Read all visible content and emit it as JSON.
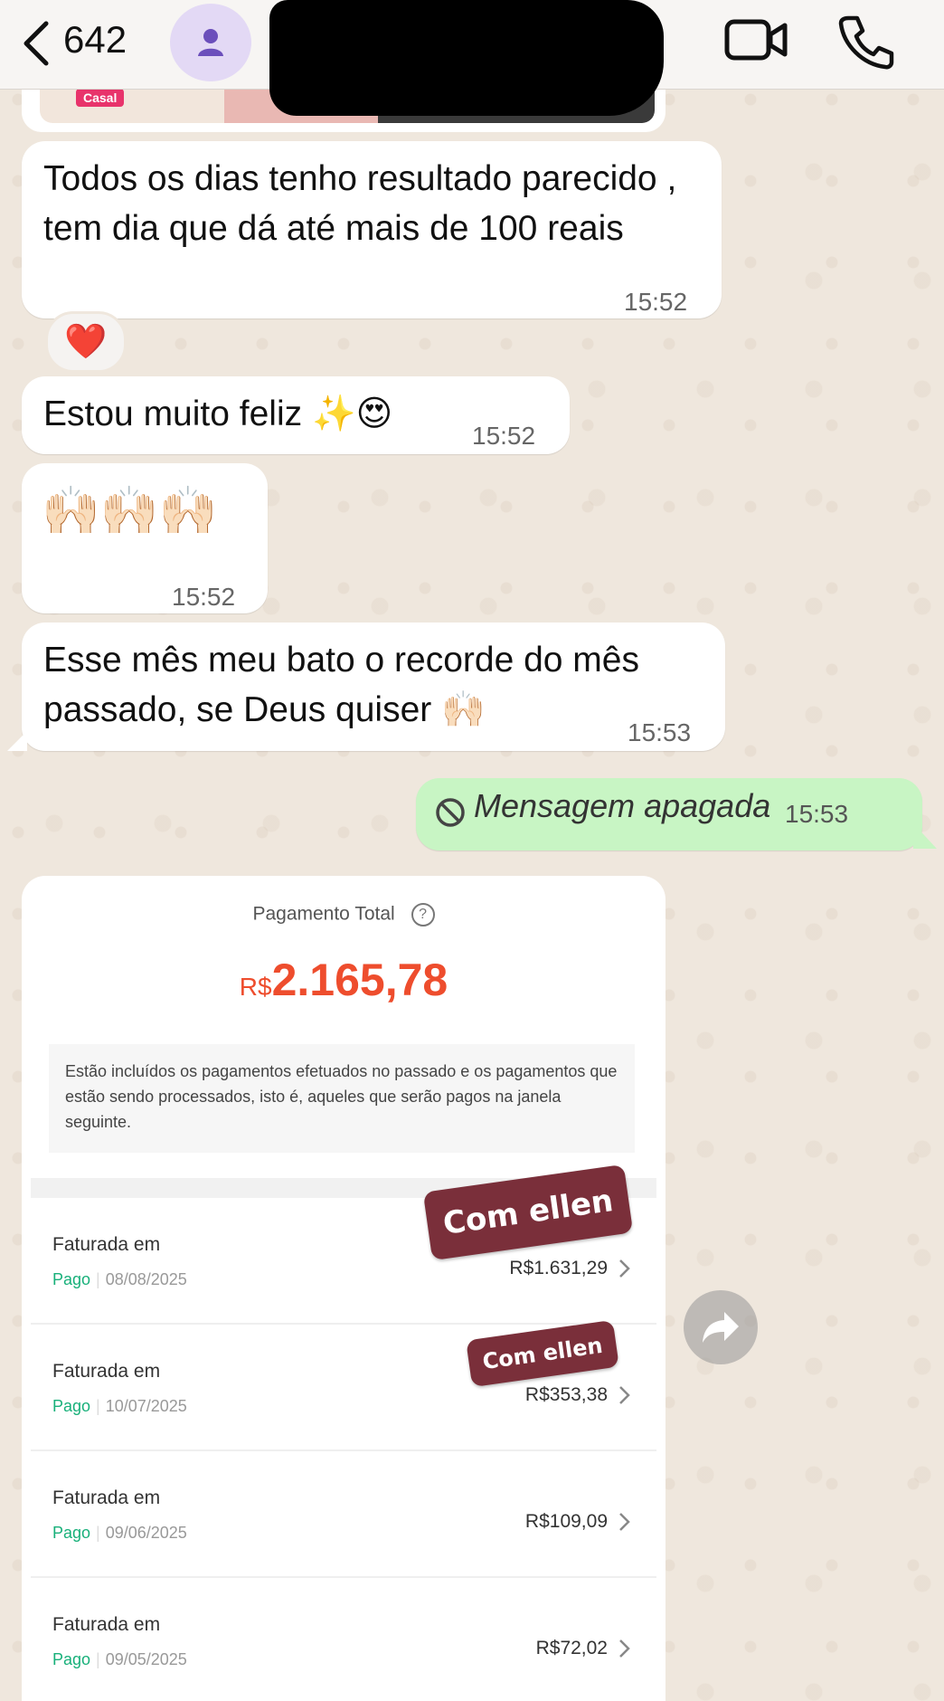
{
  "header": {
    "unread_count": "642",
    "avatar_icon": "person-icon",
    "video_icon": "video-camera-icon",
    "call_icon": "phone-icon"
  },
  "image_stub": {
    "badge": "Casal"
  },
  "messages": [
    {
      "text": "Todos os dias tenho resultado parecido , tem dia que dá até mais de 100 reais",
      "time": "15:52",
      "reaction": "❤️"
    },
    {
      "text": "Estou muito feliz ✨😍",
      "time": "15:52"
    },
    {
      "text": "🙌🏻🙌🏻🙌🏻",
      "time": "15:52"
    },
    {
      "text": "Esse mês meu bato o recorde do mês passado, se Deus quiser 🙌🏻",
      "time": "15:53"
    }
  ],
  "sent_message": {
    "text": "Mensagem apagada",
    "time": "15:53"
  },
  "payment": {
    "title": "Pagamento Total",
    "currency": "R$",
    "total": "2.165,78",
    "info": "Estão incluídos os pagamentos efetuados no passado e os pagamentos que estão sendo processados, isto é, aqueles que serão pagos na janela seguinte.",
    "rows": [
      {
        "title": "Faturada em",
        "status": "Pago",
        "date": "08/08/2025",
        "amount": "R$1.631,29"
      },
      {
        "title": "Faturada em",
        "status": "Pago",
        "date": "10/07/2025",
        "amount": "R$353,38"
      },
      {
        "title": "Faturada em",
        "status": "Pago",
        "date": "09/06/2025",
        "amount": "R$109,09"
      },
      {
        "title": "Faturada em",
        "status": "Pago",
        "date": "09/05/2025",
        "amount": "R$72,02"
      }
    ]
  },
  "stickers": [
    "Com ellen",
    "Com ellen"
  ],
  "colors": {
    "chat_bg": "#efe7dd",
    "sent_bubble": "#c8f5c4",
    "price_orange": "#ee4d2d",
    "paid_green": "#18b07a",
    "sticker_red": "#7a2f3a"
  }
}
